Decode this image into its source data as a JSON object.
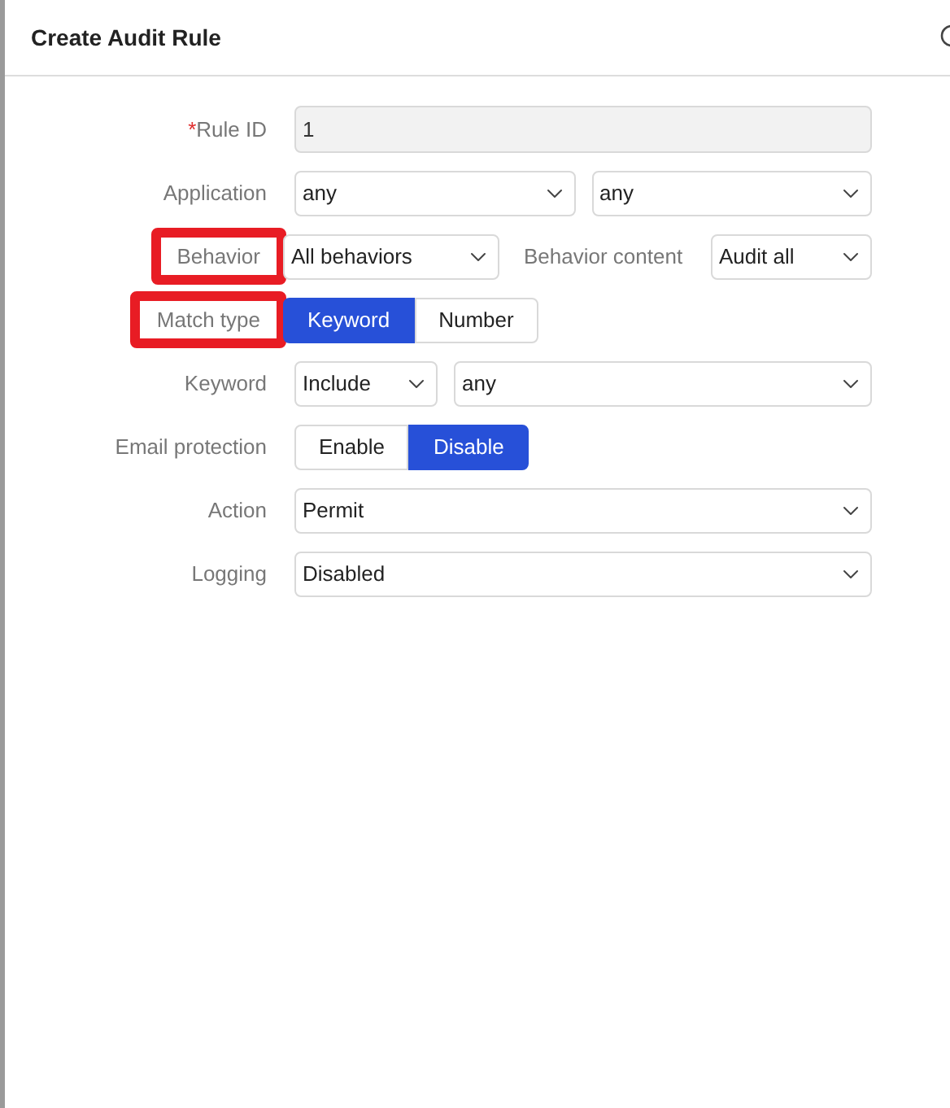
{
  "dialog": {
    "title": "Create Audit Rule"
  },
  "fields": [
    {
      "label": "Rule ID",
      "required_mark": "*",
      "highlighted": false,
      "kind": "input",
      "controls": [
        {
          "kind": "input",
          "value": "1",
          "disabled": true
        }
      ]
    },
    {
      "label": "Application",
      "highlighted": false,
      "kind": "pair",
      "controls": [
        {
          "kind": "select",
          "value": "any"
        },
        {
          "kind": "select",
          "value": "any"
        }
      ]
    },
    {
      "label": "Behavior",
      "highlighted": true,
      "kind": "compare",
      "controls": [
        {
          "kind": "select",
          "value": "All behaviors"
        },
        {
          "kind": "label",
          "value": "Behavior content"
        },
        {
          "kind": "select",
          "value": "Audit all"
        }
      ]
    },
    {
      "label": "Match type",
      "highlighted": true,
      "kind": "segmented",
      "controls": [
        {
          "kind": "segmented",
          "options": [
            {
              "label": "Keyword",
              "selected": true
            },
            {
              "label": "Number",
              "selected": false
            }
          ]
        }
      ]
    },
    {
      "label": "Keyword",
      "highlighted": false,
      "kind": "split",
      "controls": [
        {
          "kind": "select",
          "value": "Include"
        },
        {
          "kind": "select",
          "value": "any"
        }
      ]
    },
    {
      "label": "Email protection",
      "highlighted": false,
      "kind": "segmented",
      "controls": [
        {
          "kind": "segmented",
          "options": [
            {
              "label": "Enable",
              "selected": false
            },
            {
              "label": "Disable",
              "selected": true
            }
          ]
        }
      ]
    },
    {
      "label": "Action",
      "highlighted": false,
      "kind": "single",
      "controls": [
        {
          "kind": "select",
          "value": "Permit"
        }
      ]
    },
    {
      "label": "Logging",
      "highlighted": false,
      "kind": "single",
      "controls": [
        {
          "kind": "select",
          "value": "Disabled"
        }
      ]
    }
  ]
}
